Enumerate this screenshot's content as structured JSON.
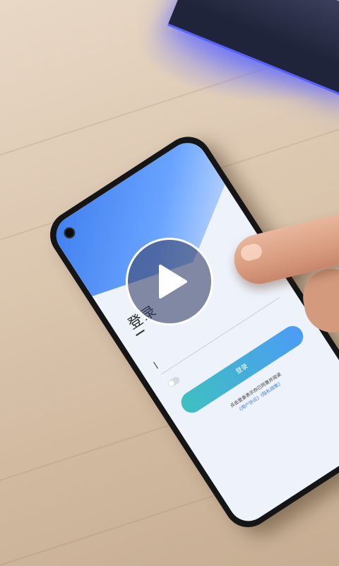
{
  "video_player": {
    "play_button_icon": "play-icon"
  },
  "phone_screen": {
    "title": "登录",
    "login_button_label": "登录",
    "agreement_text": "点击登录表示你已同意并阅读",
    "agreement_links": "《用户协议》《隐私政策》"
  },
  "colors": {
    "accent": "#4c9cf5",
    "overlay": "#3c466e"
  }
}
